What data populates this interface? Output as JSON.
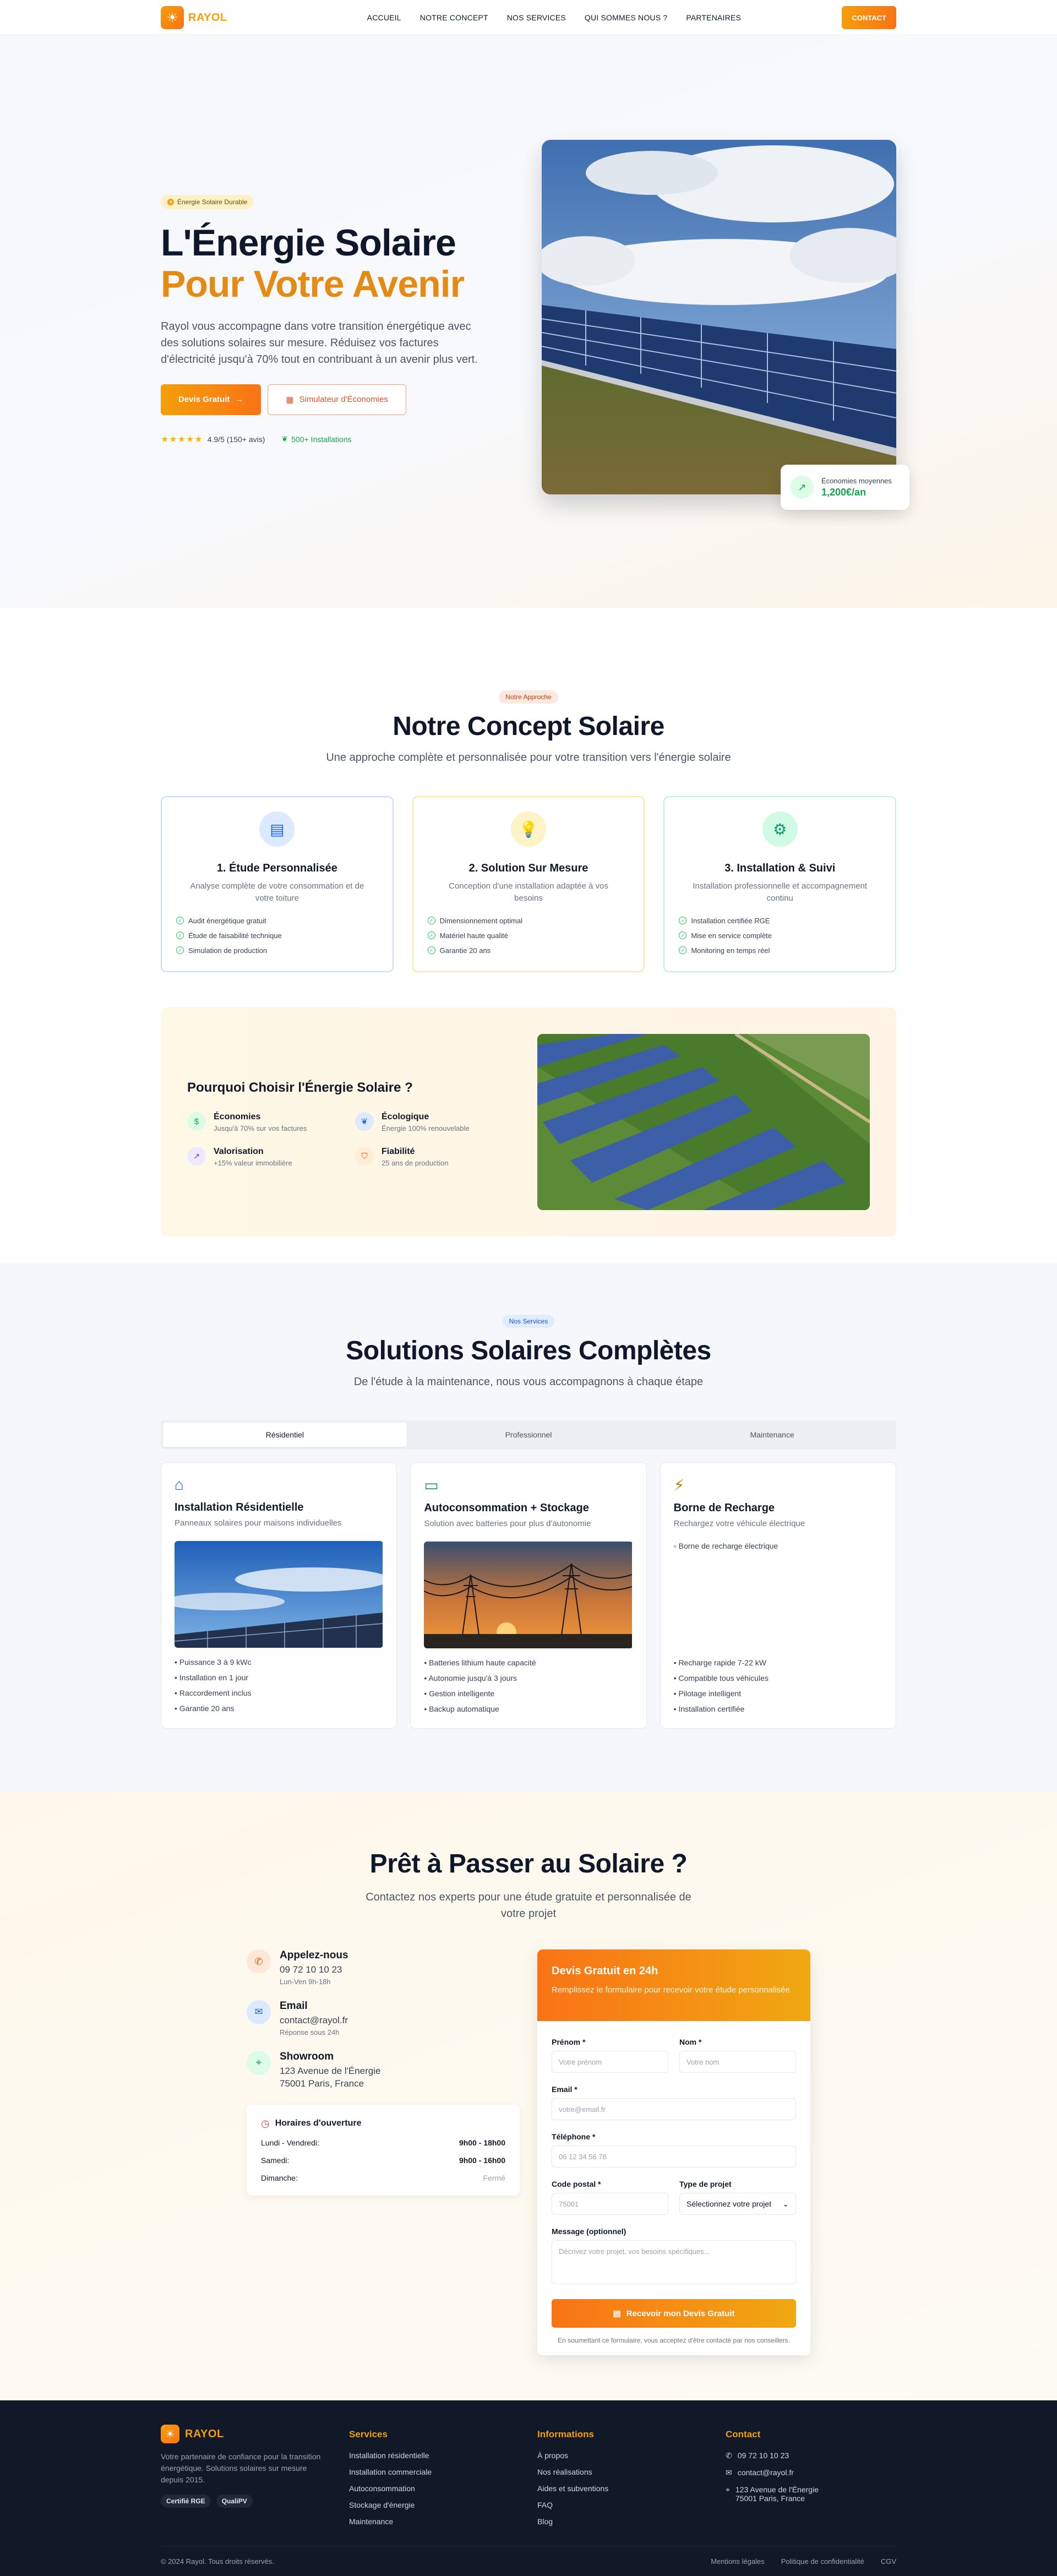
{
  "brand": {
    "name": "RAYOL",
    "icon": "sun-icon"
  },
  "nav": {
    "links": [
      "ACCUEIL",
      "NOTRE CONCEPT",
      "NOS SERVICES",
      "QUI SOMMES NOUS ?",
      "PARTENAIRES"
    ],
    "cta": "CONTACT"
  },
  "hero": {
    "badge": "Énergie Solaire Durable",
    "title_line1": "L'Énergie Solaire",
    "title_line2": "Pour Votre Avenir",
    "description": "Rayol vous accompagne dans votre transition énergétique avec des solutions solaires sur mesure. Réduisez vos factures d'électricité jusqu'à 70% tout en contribuant à un avenir plus vert.",
    "btn_primary": "Devis Gratuit",
    "btn_secondary": "Simulateur d'Économies",
    "stars": "★★★★★",
    "rating": "4.9/5 (150+ avis)",
    "installs": "500+ Installations",
    "savings_label": "Économies moyennes",
    "savings_value": "1,200€/an"
  },
  "concept": {
    "tag": "Notre Approche",
    "title": "Notre Concept Solaire",
    "subtitle": "Une approche complète et personnalisée pour votre transition vers l'énergie solaire",
    "cards": [
      {
        "title": "1. Étude Personnalisée",
        "desc": "Analyse complète de votre consommation et de votre toiture",
        "items": [
          "Audit énergétique gratuit",
          "Étude de faisabilité technique",
          "Simulation de production"
        ]
      },
      {
        "title": "2. Solution Sur Mesure",
        "desc": "Conception d'une installation adaptée à vos besoins",
        "items": [
          "Dimensionnement optimal",
          "Matériel haute qualité",
          "Garantie 20 ans"
        ]
      },
      {
        "title": "3. Installation & Suivi",
        "desc": "Installation professionnelle et accompagnement continu",
        "items": [
          "Installation certifiée RGE",
          "Mise en service complète",
          "Monitoring en temps réel"
        ]
      }
    ],
    "why": {
      "title": "Pourquoi Choisir l'Énergie Solaire ?",
      "items": [
        {
          "name": "Économies",
          "desc": "Jusqu'à 70% sur vos factures"
        },
        {
          "name": "Écologique",
          "desc": "Énergie 100% renouvelable"
        },
        {
          "name": "Valorisation",
          "desc": "+15% valeur immobilière"
        },
        {
          "name": "Fiabilité",
          "desc": "25 ans de production"
        }
      ]
    }
  },
  "services": {
    "tag": "Nos Services",
    "title": "Solutions Solaires Complètes",
    "subtitle": "De l'étude à la maintenance, nous vous accompagnons à chaque étape",
    "tabs": [
      "Résidentiel",
      "Professionnel",
      "Maintenance"
    ],
    "cards": [
      {
        "title": "Installation Résidentielle",
        "desc": "Panneaux solaires pour maisons individuelles",
        "items": [
          "• Puissance 3 à 9 kWc",
          "• Installation en 1 jour",
          "• Raccordement inclus",
          "• Garantie 20 ans"
        ]
      },
      {
        "title": "Autoconsommation + Stockage",
        "desc": "Solution avec batteries pour plus d'autonomie",
        "items": [
          "• Batteries lithium haute capacité",
          "• Autonomie jusqu'à 3 jours",
          "• Gestion intelligente",
          "• Backup automatique"
        ]
      },
      {
        "title": "Borne de Recharge",
        "desc": "Rechargez votre véhicule électrique",
        "img_alt": "Borne de recharge électrique",
        "items": [
          "• Recharge rapide 7-22 kW",
          "• Compatible tous véhicules",
          "• Pilotage intelligent",
          "• Installation certifiée"
        ]
      }
    ]
  },
  "contact": {
    "title": "Prêt à Passer au Solaire ?",
    "subtitle": "Contactez nos experts pour une étude gratuite et personnalisée de votre projet",
    "phone": {
      "label": "Appelez-nous",
      "value": "09 72 10 10 23",
      "note": "Lun-Ven 9h-18h"
    },
    "email": {
      "label": "Email",
      "value": "contact@rayol.fr",
      "note": "Réponse sous 24h"
    },
    "showroom": {
      "label": "Showroom",
      "line1": "123 Avenue de l'Énergie",
      "line2": "75001 Paris, France"
    },
    "hours": {
      "title": "Horaires d'ouverture",
      "rows": [
        {
          "day": "Lundi - Vendredi:",
          "time": "9h00 - 18h00"
        },
        {
          "day": "Samedi:",
          "time": "9h00 - 16h00"
        },
        {
          "day": "Dimanche:",
          "time": "Fermé"
        }
      ]
    },
    "form": {
      "head_title": "Devis Gratuit en 24h",
      "head_sub": "Remplissez le formulaire pour recevoir votre étude personnalisée",
      "firstname_label": "Prénom *",
      "firstname_ph": "Votre prénom",
      "lastname_label": "Nom *",
      "lastname_ph": "Votre nom",
      "email_label": "Email *",
      "email_ph": "votre@email.fr",
      "phone_label": "Téléphone *",
      "phone_ph": "06 12 34 56 78",
      "zip_label": "Code postal *",
      "zip_ph": "75001",
      "project_label": "Type de projet",
      "project_value": "Sélectionnez votre projet",
      "message_label": "Message (optionnel)",
      "message_ph": "Décrivez votre projet, vos besoins spécifiques...",
      "submit": "Recevoir mon Devis Gratuit",
      "note": "En soumettant ce formulaire, vous acceptez d'être contacté par nos conseillers."
    }
  },
  "footer": {
    "about": "Votre partenaire de confiance pour la transition énergétique. Solutions solaires sur mesure depuis 2015.",
    "badges": [
      "Certifié RGE",
      "QualiPV"
    ],
    "services_title": "Services",
    "services": [
      "Installation résidentielle",
      "Installation commerciale",
      "Autoconsommation",
      "Stockage d'énergie",
      "Maintenance"
    ],
    "info_title": "Informations",
    "info": [
      "À propos",
      "Nos réalisations",
      "Aides et subventions",
      "FAQ",
      "Blog"
    ],
    "contact_title": "Contact",
    "contact_phone": "09 72 10 10 23",
    "contact_email": "contact@rayol.fr",
    "contact_addr1": "123 Avenue de l'Énergie",
    "contact_addr2": "75001 Paris, France",
    "copyright": "© 2024 Rayol. Tous droits réservés.",
    "legal": [
      "Mentions légales",
      "Politique de confidentialité",
      "CGV"
    ]
  },
  "colors": {
    "accent": "#f59e0b",
    "accent2": "#f97316",
    "footer_bg": "#111827"
  }
}
